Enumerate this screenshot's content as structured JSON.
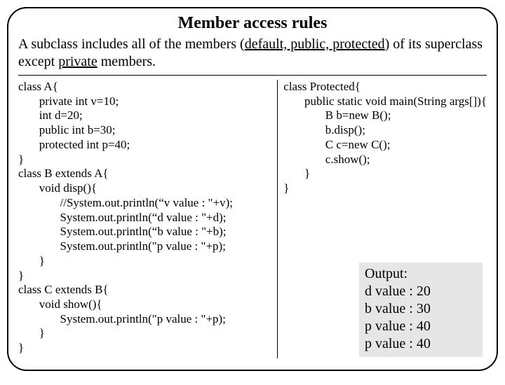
{
  "title": "Member access rules",
  "intro": {
    "pre": "A subclass includes all of the members (",
    "u1": "default, public, protected",
    "mid": ") of its superclass except ",
    "u2": "private",
    "post": "  members."
  },
  "code_left": "class A{\n       private int v=10;\n       int d=20;\n       public int b=30;\n       protected int p=40;\n}\nclass B extends A{\n       void disp(){\n              //System.out.println(“v value : \"+v);\n              System.out.println(“d value : \"+d);\n              System.out.println(“b value : \"+b);\n              System.out.println(\"p value : \"+p);\n       }\n}\nclass C extends B{\n       void show(){\n              System.out.println(\"p value : \"+p);\n       }\n}",
  "code_right": "class Protected{\n       public static void main(String args[]){\n              B b=new B();\n              b.disp();\n              C c=new C();\n              c.show();\n       }\n}",
  "output": {
    "heading": "Output:",
    "lines": [
      "d value : 20",
      "b value : 30",
      "p value : 40",
      "p value : 40"
    ]
  }
}
